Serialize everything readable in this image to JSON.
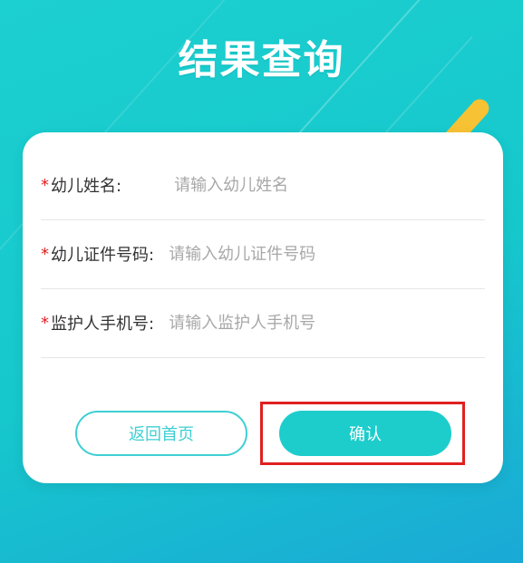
{
  "page": {
    "title": "结果查询"
  },
  "form": {
    "required_mark": "*",
    "fields": [
      {
        "label": "幼儿姓名:",
        "placeholder": "请输入幼儿姓名",
        "value": ""
      },
      {
        "label": "幼儿证件号码:",
        "placeholder": "请输入幼儿证件号码",
        "value": ""
      },
      {
        "label": "监护人手机号:",
        "placeholder": "请输入监护人手机号",
        "value": ""
      }
    ]
  },
  "actions": {
    "back_label": "返回首页",
    "confirm_label": "确认"
  },
  "colors": {
    "accent": "#1ccdcc",
    "required": "#e02020",
    "highlight": "#e02020"
  }
}
